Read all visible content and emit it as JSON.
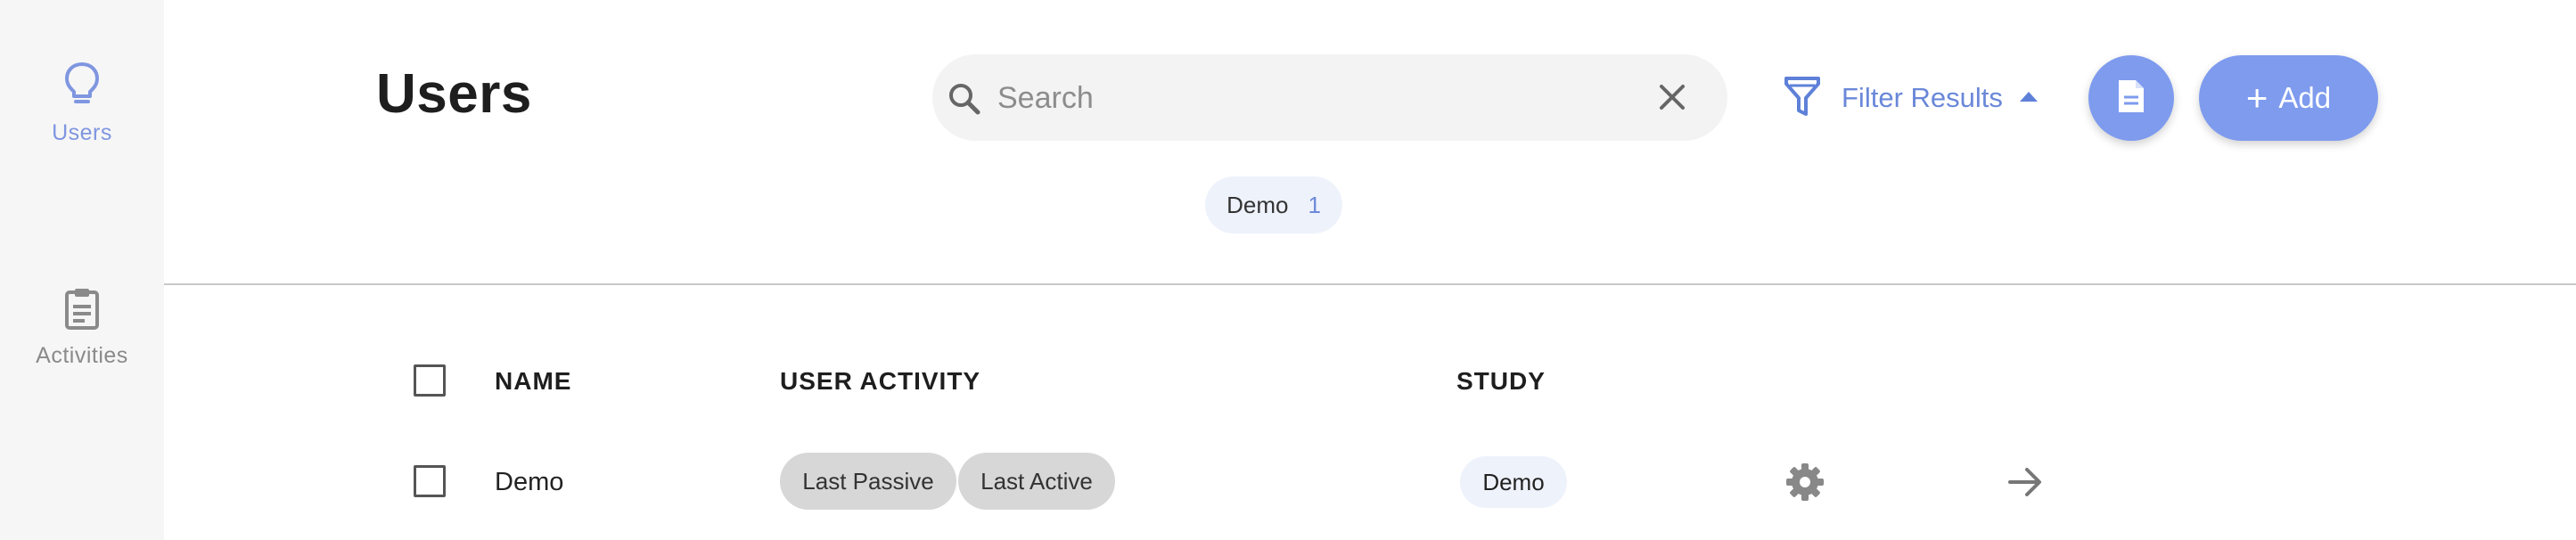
{
  "sidebar": {
    "items": [
      {
        "label": "Users",
        "icon": "lightbulb-icon",
        "active": true
      },
      {
        "label": "Activities",
        "icon": "clipboard-icon",
        "active": false
      }
    ]
  },
  "header": {
    "title": "Users",
    "search": {
      "placeholder": "Search",
      "value": ""
    },
    "filter_label": "Filter Results",
    "add_label": "Add"
  },
  "filter_chips": [
    {
      "name": "Demo",
      "count": "1"
    }
  ],
  "table": {
    "columns": [
      "NAME",
      "USER ACTIVITY",
      "STUDY"
    ],
    "rows": [
      {
        "name": "Demo",
        "activity_tags": [
          "Last Passive",
          "Last Active"
        ],
        "study": "Demo"
      }
    ]
  },
  "colors": {
    "accent": "#7e9bee",
    "sidebar_bg": "#f6f6f6",
    "active_nav": "#7f96e0",
    "tag_bg": "#d7d7d7",
    "chip_bg": "#eef2fb"
  }
}
